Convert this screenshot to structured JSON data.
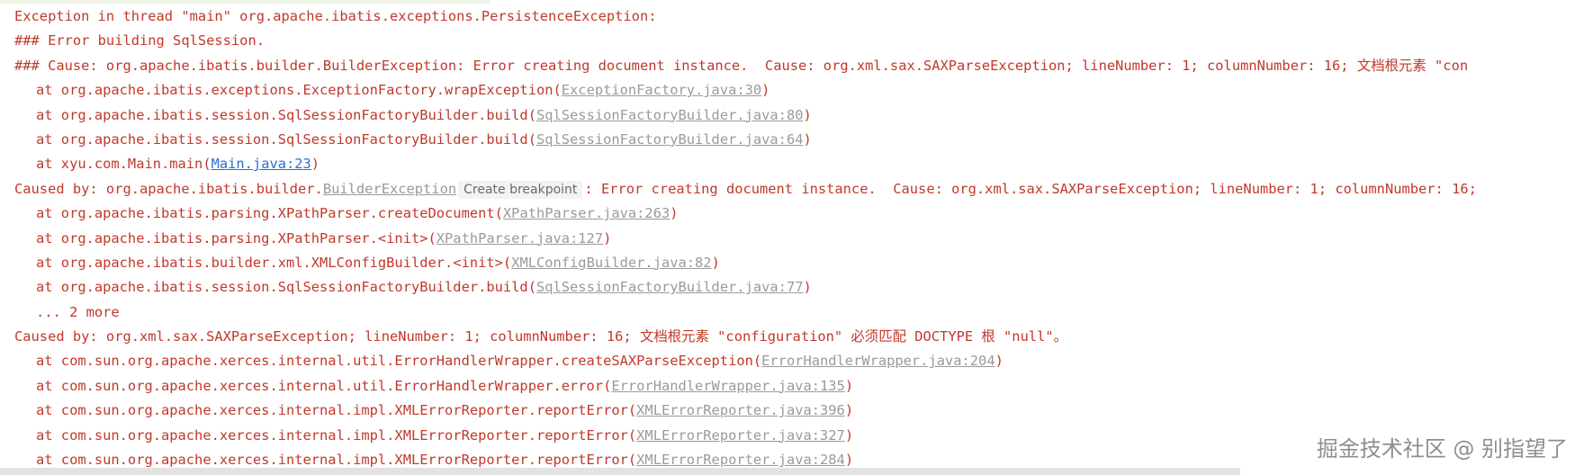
{
  "console": {
    "l1": "Exception in thread \"main\" org.apache.ibatis.exceptions.PersistenceException:",
    "l2": "### Error building SqlSession.",
    "l3": "### Cause: org.apache.ibatis.builder.BuilderException: Error creating document instance.  Cause: org.xml.sax.SAXParseException; lineNumber: 1; columnNumber: 16; 文档根元素 \"con",
    "l4_pre": "at org.apache.ibatis.exceptions.ExceptionFactory.wrapException(",
    "l4_link": "ExceptionFactory.java:30",
    "l5_pre": "at org.apache.ibatis.session.SqlSessionFactoryBuilder.build(",
    "l5_link": "SqlSessionFactoryBuilder.java:80",
    "l6_pre": "at org.apache.ibatis.session.SqlSessionFactoryBuilder.build(",
    "l6_link": "SqlSessionFactoryBuilder.java:64",
    "l7_pre": "at xyu.com.Main.main(",
    "l7_link": "Main.java:23",
    "l8_pre": "Caused by: org.apache.ibatis.builder.",
    "l8_class": "BuilderException",
    "l8_hint": "Create breakpoint",
    "l8_post": ": Error creating document instance.  Cause: org.xml.sax.SAXParseException; lineNumber: 1; columnNumber: 16;",
    "l9_pre": "at org.apache.ibatis.parsing.XPathParser.createDocument(",
    "l9_link": "XPathParser.java:263",
    "l10_pre": "at org.apache.ibatis.parsing.XPathParser.<init>(",
    "l10_link": "XPathParser.java:127",
    "l11_pre": "at org.apache.ibatis.builder.xml.XMLConfigBuilder.<init>(",
    "l11_link": "XMLConfigBuilder.java:82",
    "l12_pre": "at org.apache.ibatis.session.SqlSessionFactoryBuilder.build(",
    "l12_link": "SqlSessionFactoryBuilder.java:77",
    "l13": "... 2 more",
    "l14": "Caused by: org.xml.sax.SAXParseException; lineNumber: 1; columnNumber: 16; 文档根元素 \"configuration\" 必须匹配 DOCTYPE 根 \"null\"。",
    "l15_pre": "at com.sun.org.apache.xerces.internal.util.ErrorHandlerWrapper.createSAXParseException(",
    "l15_link": "ErrorHandlerWrapper.java:204",
    "l16_pre": "at com.sun.org.apache.xerces.internal.util.ErrorHandlerWrapper.error(",
    "l16_link": "ErrorHandlerWrapper.java:135",
    "l17_pre": "at com.sun.org.apache.xerces.internal.impl.XMLErrorReporter.reportError(",
    "l17_link": "XMLErrorReporter.java:396",
    "l18_pre": "at com.sun.org.apache.xerces.internal.impl.XMLErrorReporter.reportError(",
    "l18_link": "XMLErrorReporter.java:327",
    "l19_pre": "at com.sun.org.apache.xerces.internal.impl.XMLErrorReporter.reportError(",
    "l19_link": "XMLErrorReporter.java:284",
    "close_paren": ")"
  },
  "watermark": "掘金技术社区 @ 别指望了",
  "colors": {
    "error_text": "#c0392b",
    "link_gray": "#9a9a9a",
    "link_blue": "#2a6fd6"
  }
}
